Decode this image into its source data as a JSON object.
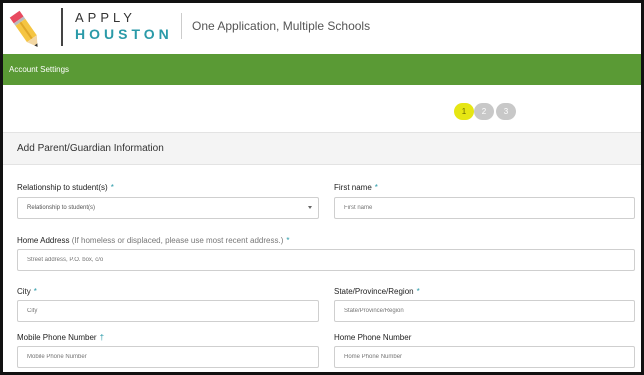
{
  "brand": {
    "line1": "APPLY",
    "line2": "HOUSTON",
    "tagline": "One Application, Multiple Schools"
  },
  "nav": {
    "account_settings": "Account Settings"
  },
  "stepper": {
    "steps": [
      "1",
      "2",
      "3"
    ],
    "active": 1
  },
  "section": {
    "title": "Add Parent/Guardian Information"
  },
  "form": {
    "relationship": {
      "label": "Relationship to student(s)",
      "req": "*",
      "selected": "Relationship to student(s)"
    },
    "first_name": {
      "label": "First name",
      "req": "*",
      "placeholder": "First name"
    },
    "home_address": {
      "label": "Home Address",
      "hint": "(If homeless or displaced, please use most recent address.)",
      "req": "*",
      "placeholder": "Street address, P.O. box, c/o"
    },
    "city": {
      "label": "City",
      "req": "*",
      "placeholder": "City"
    },
    "state": {
      "label": "State/Province/Region",
      "req": "*",
      "placeholder": "State/Province/Region"
    },
    "mobile_phone": {
      "label": "Mobile Phone Number",
      "req": "†",
      "placeholder": "Mobile Phone Number"
    },
    "home_phone": {
      "label": "Home Phone Number",
      "placeholder": "Home Phone Number"
    }
  },
  "colors": {
    "nav_green": "#5a9a35",
    "brand_teal": "#2a9aa8",
    "step_active": "#e6e614",
    "step_inactive": "#c8c8c8"
  }
}
